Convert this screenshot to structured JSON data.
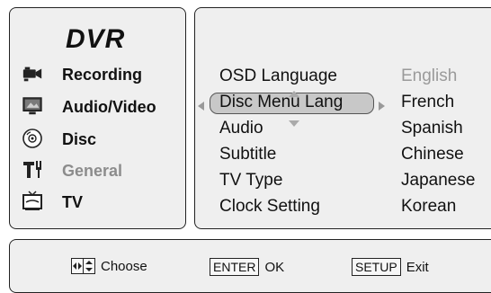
{
  "sidebar": {
    "title": "DVR",
    "items": [
      {
        "label": "Recording",
        "icon": "camera-icon",
        "enabled": true
      },
      {
        "label": "Audio/Video",
        "icon": "monitor-icon",
        "enabled": true
      },
      {
        "label": "Disc",
        "icon": "disc-icon",
        "enabled": true
      },
      {
        "label": "General",
        "icon": "tools-icon",
        "enabled": false
      },
      {
        "label": "TV",
        "icon": "tv-icon",
        "enabled": true
      }
    ]
  },
  "settings": {
    "rows": [
      {
        "label": "OSD Language",
        "value": "English",
        "selected": false,
        "value_dim": true
      },
      {
        "label": "Disc Menu Lang",
        "value": "French",
        "selected": true,
        "value_dim": false
      },
      {
        "label": "Audio",
        "value": "Spanish",
        "selected": false,
        "value_dim": false
      },
      {
        "label": "Subtitle",
        "value": "Chinese",
        "selected": false,
        "value_dim": false
      },
      {
        "label": "TV Type",
        "value": "Japanese",
        "selected": false,
        "value_dim": false
      },
      {
        "label": "Clock Setting",
        "value": "Korean",
        "selected": false,
        "value_dim": false
      }
    ]
  },
  "footer": {
    "choose_label": "Choose",
    "enter_key": "ENTER",
    "enter_label": "OK",
    "setup_key": "SETUP",
    "setup_label": "Exit"
  },
  "colors": {
    "panel_bg": "#efefef",
    "highlight_bg": "#c8c8c8",
    "dim_text": "#9a9a9a"
  }
}
